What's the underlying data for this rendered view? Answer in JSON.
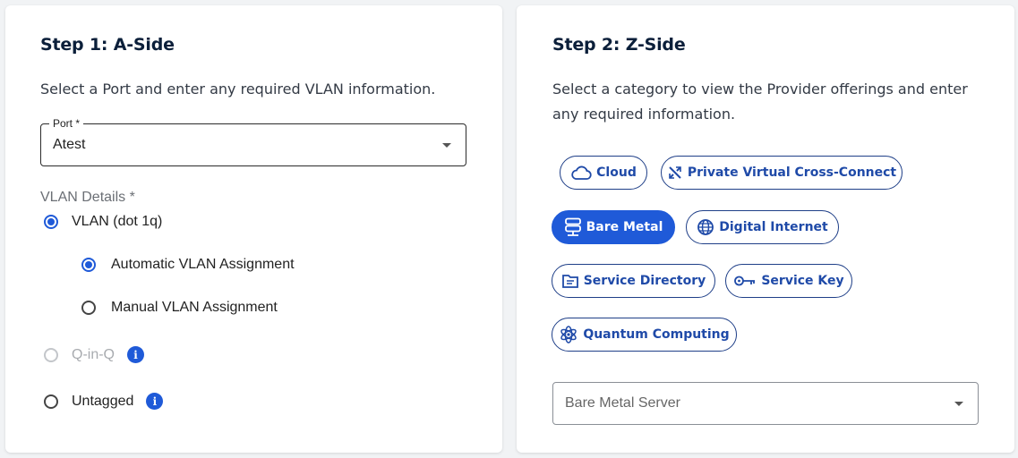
{
  "step_a": {
    "title": "Step 1: A-Side",
    "description": "Select a Port and enter any required VLAN information.",
    "port_label": "Port *",
    "port_value": "Atest",
    "vlan_details_label": "VLAN Details *",
    "options": {
      "vlan": "VLAN (dot 1q)",
      "automatic": "Automatic VLAN Assignment",
      "manual": "Manual VLAN Assignment",
      "qinq": "Q-in-Q",
      "untagged": "Untagged"
    }
  },
  "step_z": {
    "title": "Step 2: Z-Side",
    "description_line1": "Select a category to view the Provider offerings and enter",
    "description_line2": "any required information.",
    "categories": {
      "cloud": "Cloud",
      "pvcc": "Private Virtual Cross-Connect",
      "bare_metal": "Bare Metal",
      "digital_internet": "Digital Internet",
      "service_directory": "Service Directory",
      "service_key": "Service Key",
      "quantum_computing": "Quantum Computing"
    },
    "selected_category": "Bare Metal",
    "provider_placeholder": "Bare Metal Server"
  },
  "colors": {
    "accent": "#1f5ad8",
    "chip_text": "#1f4aa8",
    "title": "#0b1f3a"
  }
}
